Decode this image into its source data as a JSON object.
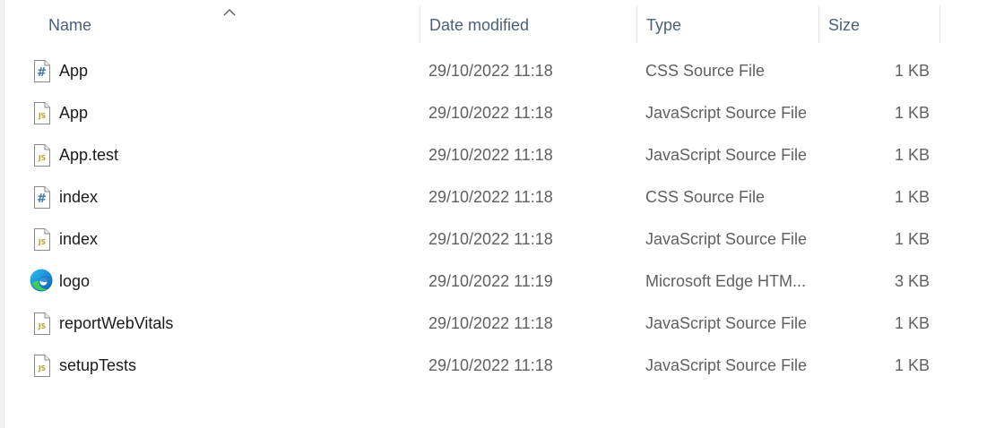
{
  "columns": {
    "name": "Name",
    "date": "Date modified",
    "type": "Type",
    "size": "Size"
  },
  "sort": {
    "column": "name",
    "direction": "ascending"
  },
  "files": [
    {
      "name": "App",
      "date": "29/10/2022 11:18",
      "type": "CSS Source File",
      "size": "1 KB",
      "icon": "css-file-icon"
    },
    {
      "name": "App",
      "date": "29/10/2022 11:18",
      "type": "JavaScript Source File",
      "size": "1 KB",
      "icon": "js-file-icon"
    },
    {
      "name": "App.test",
      "date": "29/10/2022 11:18",
      "type": "JavaScript Source File",
      "size": "1 KB",
      "icon": "js-file-icon"
    },
    {
      "name": "index",
      "date": "29/10/2022 11:18",
      "type": "CSS Source File",
      "size": "1 KB",
      "icon": "css-file-icon"
    },
    {
      "name": "index",
      "date": "29/10/2022 11:18",
      "type": "JavaScript Source File",
      "size": "1 KB",
      "icon": "js-file-icon"
    },
    {
      "name": "logo",
      "date": "29/10/2022 11:19",
      "type": "Microsoft Edge HTM...",
      "size": "3 KB",
      "icon": "edge-browser-icon"
    },
    {
      "name": "reportWebVitals",
      "date": "29/10/2022 11:18",
      "type": "JavaScript Source File",
      "size": "1 KB",
      "icon": "js-file-icon"
    },
    {
      "name": "setupTests",
      "date": "29/10/2022 11:18",
      "type": "JavaScript Source File",
      "size": "1 KB",
      "icon": "js-file-icon"
    }
  ],
  "colors": {
    "header_text": "#4c607a",
    "secondary_text": "#606060",
    "primary_text": "#1a1a1a"
  }
}
